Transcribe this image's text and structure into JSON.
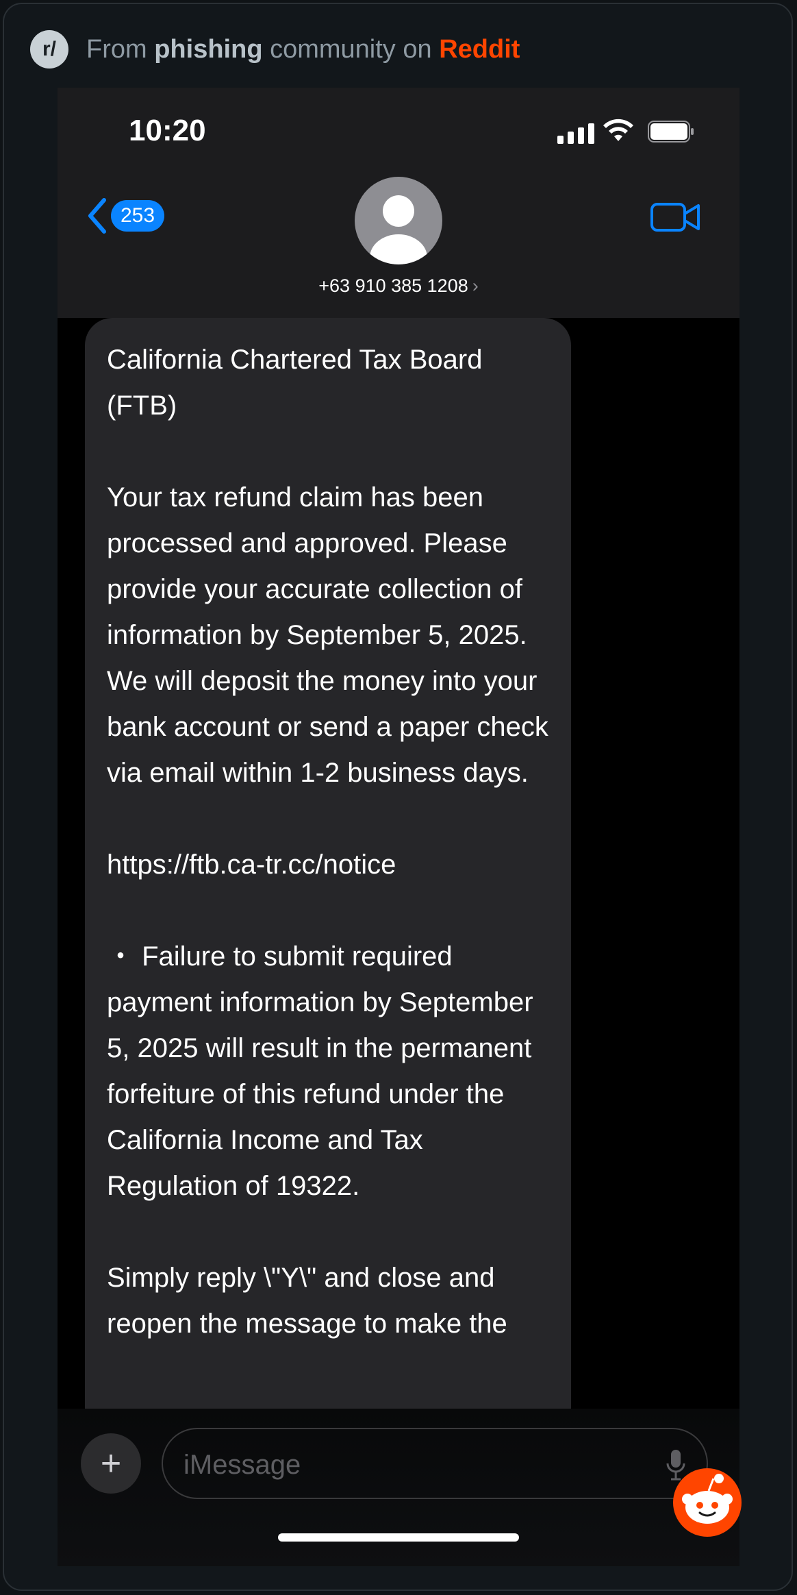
{
  "reddit_header": {
    "logo": "r/",
    "from": "From ",
    "community": "phishing",
    "middle": " community on ",
    "brand": "Reddit"
  },
  "status_bar": {
    "time": "10:20",
    "icons": [
      "signal-icon",
      "wifi-icon",
      "battery-icon"
    ]
  },
  "nav": {
    "back_count": "253",
    "contact_number": "+63 910 385 1208",
    "contact_chevron": "›",
    "icons": [
      "back-chevron-icon",
      "contact-avatar-icon",
      "video-call-icon"
    ]
  },
  "message": {
    "paragraphs": [
      "California Chartered Tax Board (FTB)",
      "Your tax refund claim has been processed and approved. Please provide your accurate collection of information by September 5, 2025. We will deposit the money into your bank account or send a paper check via email within 1-2 business days.",
      "https://ftb.ca-tr.cc/notice",
      " ・ Failure to submit required payment information by September 5, 2025 will result in the permanent forfeiture of this refund under the California Income and Tax Regulation of 19322.",
      "Simply reply \\\"Y\\\" and close and reopen the message to make the"
    ]
  },
  "composer": {
    "plus_label": "+",
    "placeholder": "iMessage",
    "icons": [
      "plus-icon",
      "microphone-icon",
      "reddit-snoo-icon"
    ]
  },
  "colors": {
    "accent_blue": "#0a84ff",
    "reddit_orange": "#ff4500",
    "bubble_bg": "#262629"
  }
}
